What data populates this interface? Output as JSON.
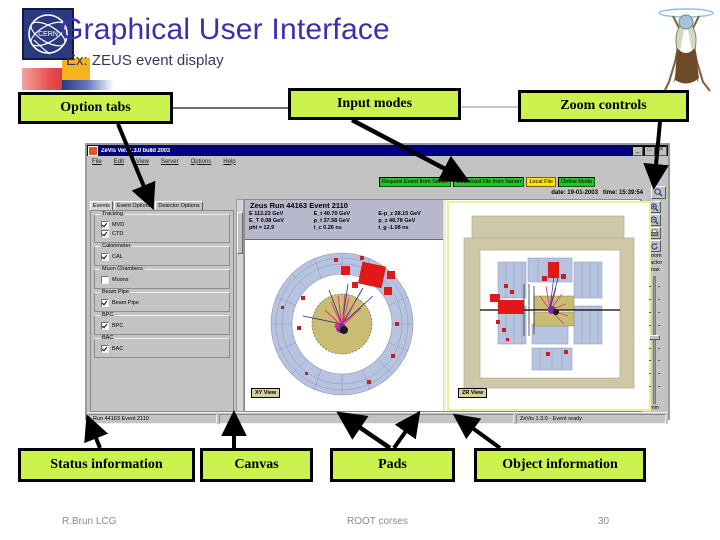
{
  "slide": {
    "title": "Graphical User Interface",
    "subtitle": "Ex: ZEUS event display",
    "logo_text": "CERN"
  },
  "callouts": [
    {
      "id": "option-tabs",
      "label": "Option tabs"
    },
    {
      "id": "input-modes",
      "label": "Input modes"
    },
    {
      "id": "zoom-controls",
      "label": "Zoom controls"
    },
    {
      "id": "status-information",
      "label": "Status information"
    },
    {
      "id": "canvas",
      "label": "Canvas"
    },
    {
      "id": "pads",
      "label": "Pads"
    },
    {
      "id": "object-information",
      "label": "Object information"
    }
  ],
  "app": {
    "title": "ZeVis Ver. 1.3.0 build 2003",
    "window_buttons": {
      "minimize": "_",
      "maximize": "□",
      "close": "×"
    },
    "menus": [
      "File",
      "Edit",
      "View",
      "Server",
      "Options",
      "Help"
    ],
    "help_label": "Help",
    "input_modes": [
      {
        "label": "Request Event from Server",
        "state": "normal"
      },
      {
        "label": "Download File from Server",
        "state": "normal"
      },
      {
        "label": "Local File",
        "state": "active"
      },
      {
        "label": "Online Mode",
        "state": "normal"
      }
    ],
    "date_label": "date:",
    "date_value": "19-01-2003",
    "time_label": "time:",
    "time_value": "15:39:54",
    "magnify_icon": "magnifier-icon",
    "tabs": [
      {
        "label": "Events",
        "selected": true
      },
      {
        "label": "Event Options",
        "selected": false
      },
      {
        "label": "Detector Options",
        "selected": false
      }
    ],
    "option_groups": [
      {
        "title": "Tracking",
        "items": [
          {
            "label": "MVD",
            "checked": true
          },
          {
            "label": "CTD",
            "checked": true
          }
        ]
      },
      {
        "title": "Calorimeter",
        "items": [
          {
            "label": "CAL",
            "checked": true
          }
        ]
      },
      {
        "title": "Muon Chambers",
        "items": [
          {
            "label": "Muons",
            "checked": false
          }
        ]
      },
      {
        "title": "Beam Pipe",
        "items": [
          {
            "label": "Beam Pipe",
            "checked": true
          }
        ]
      },
      {
        "title": "BPC",
        "items": [
          {
            "label": "BPC",
            "checked": true
          }
        ]
      },
      {
        "title": "BAC",
        "items": [
          {
            "label": "BAC",
            "checked": true
          }
        ]
      }
    ],
    "event": {
      "header": "Zeus Run 44163 Event 2110",
      "fields": [
        {
          "label": "E",
          "value": "113.23 GeV"
        },
        {
          "label": "E_t",
          "value": "40.70 GeV"
        },
        {
          "label": "E-p_z",
          "value": "28.15 GeV"
        },
        {
          "label": "E_T",
          "value": "0.08 GeV"
        },
        {
          "label": "p_t",
          "value": "37.58 GeV"
        },
        {
          "label": "p_z",
          "value": "48.78 GeV"
        },
        {
          "label": "phi =",
          "value": "12.9"
        },
        {
          "label": "t_c",
          "value": "0.26 ns"
        },
        {
          "label": "t_g",
          "value": "-1.08 ns"
        }
      ]
    },
    "view_labels": {
      "xy": "XY View",
      "zr": "ZR View"
    },
    "zoom": {
      "buttons": [
        "zoom-in-icon",
        "zoom-out-icon",
        "print-icon",
        "rotate-icon"
      ],
      "title_line1": "Zoom",
      "title_line2": "Factor",
      "max_label": "max",
      "min_label": "min"
    },
    "status": {
      "left": "Run 44163 Event 2110",
      "middle": "",
      "right": "ZeVis 1.3.0 - Event ready"
    }
  },
  "footer": {
    "left": "R.Brun LCG",
    "center": "ROOT corses",
    "right": "30"
  },
  "colors": {
    "callout_fill": "#ccf24d",
    "title_purple": "#3b2fb0",
    "titlebar_blue": "#00007e",
    "mode_green": "#22c322",
    "mode_active_yellow": "#ffe400",
    "event_header": "#b8b8cc",
    "detector_blue": "#b6c4e0",
    "energy_red": "#e01818",
    "beampipe_olive": "#c9bd73"
  }
}
